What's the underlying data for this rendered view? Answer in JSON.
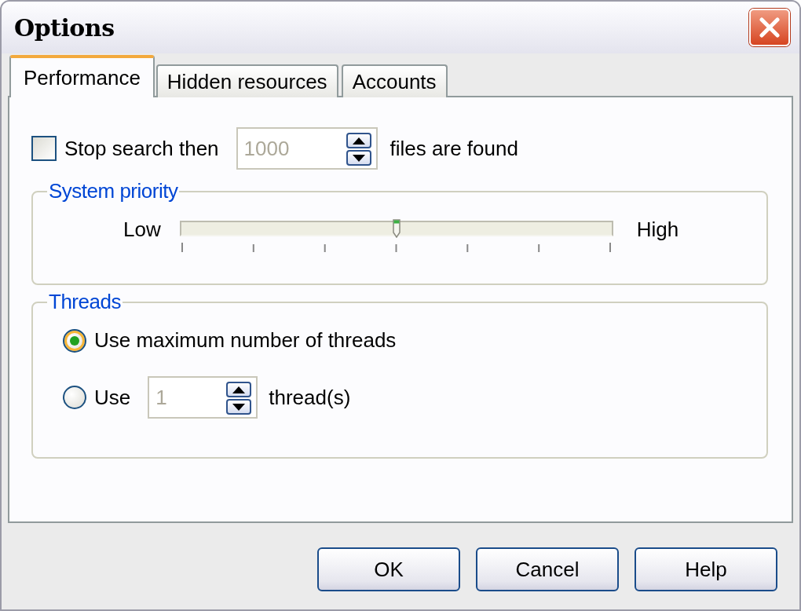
{
  "window": {
    "title": "Options"
  },
  "tabs": [
    {
      "label": "Performance",
      "selected": true
    },
    {
      "label": "Hidden resources",
      "selected": false
    },
    {
      "label": "Accounts",
      "selected": false
    }
  ],
  "stop_search": {
    "label": "Stop search then",
    "checked": false,
    "value": "1000",
    "disabled": true,
    "suffix": "files are found"
  },
  "system_priority": {
    "title": "System priority",
    "low_label": "Low",
    "high_label": "High",
    "level": 0.5
  },
  "threads": {
    "title": "Threads",
    "options": [
      {
        "kind": "plain",
        "label": "Use maximum number of threads",
        "selected": true
      },
      {
        "kind": "count",
        "label": "Use",
        "selected": false,
        "value": "1",
        "disabled": true,
        "suffix": "thread(s)"
      }
    ]
  },
  "buttons": [
    "OK",
    "Cancel",
    "Help"
  ]
}
